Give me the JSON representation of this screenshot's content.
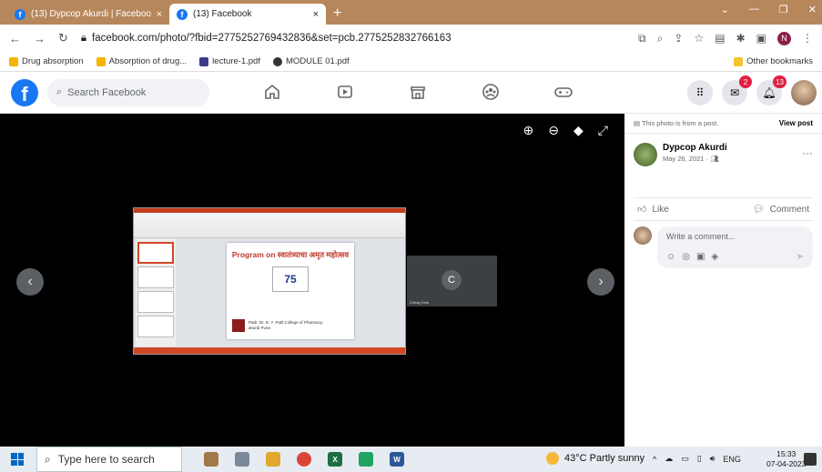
{
  "browser": {
    "tabs": [
      {
        "title": "(13) Dypcop Akurdi | Facebook",
        "active": false
      },
      {
        "title": "(13) Facebook",
        "active": true
      }
    ],
    "new_tab_label": "+",
    "close_label": "×",
    "url_host": "facebook.com",
    "url_path": "/photo/?fbid=2775252769432836&set=pcb.2775252832766163",
    "profile_initial": "N"
  },
  "bookmarks": [
    {
      "label": "Drug absorption",
      "color": "#f4b400"
    },
    {
      "label": "Absorption of drug...",
      "color": "#f4b400"
    },
    {
      "label": "lecture-1.pdf",
      "color": "#3c3c8c"
    },
    {
      "label": "MODULE 01.pdf",
      "color": "#333333"
    }
  ],
  "other_bookmarks": "Other bookmarks",
  "facebook": {
    "logo": "f",
    "search_placeholder": "Search Facebook",
    "messenger_badge": "2",
    "notifications_badge": "13"
  },
  "photo": {
    "slide_title": "Program on स्वातंत्र्याचा अमृत महोत्सव",
    "slide_logo_text": "75",
    "slide_footer": "Padr. Dr. D. Y. Patil College of Pharmacy, akurdi Pune",
    "video_initial": "C",
    "video_name": "Chirag Seth"
  },
  "panel": {
    "from_post_text": "This photo is from a post.",
    "view_post_label": "View post",
    "author": "Dypcop Akurdi",
    "date": "May 26, 2021 · ",
    "more_label": "···",
    "like_label": "Like",
    "comment_label": "Comment",
    "comment_placeholder": "Write a comment..."
  },
  "taskbar": {
    "search_placeholder": "Type here to search",
    "weather": "43°C  Partly sunny",
    "lang": "ENG",
    "time": "15:33",
    "date": "07-04-2023"
  },
  "colors": {
    "tabstrip": "#b7875c",
    "fb_blue": "#1877f2",
    "badge": "#e41e3f"
  }
}
